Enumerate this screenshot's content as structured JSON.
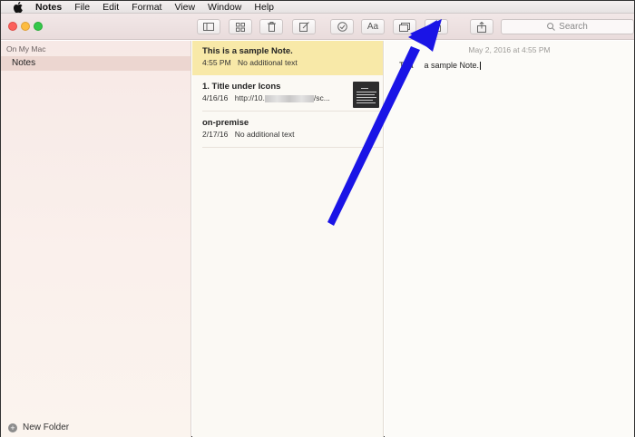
{
  "menubar": {
    "app_name": "Notes",
    "items": [
      "File",
      "Edit",
      "Format",
      "View",
      "Window",
      "Help"
    ]
  },
  "toolbar": {
    "buttons": [
      {
        "name": "sidebar-toggle-button",
        "icon": "sidebar-icon"
      },
      {
        "name": "gallery-view-button",
        "icon": "grid-icon"
      },
      {
        "name": "delete-button",
        "icon": "trash-icon"
      },
      {
        "name": "compose-button",
        "icon": "compose-icon"
      },
      {
        "name": "checklist-button",
        "icon": "checkmark-circle-icon"
      },
      {
        "name": "format-button",
        "icon": "text-format-icon",
        "label": "Aa"
      },
      {
        "name": "attachments-button",
        "icon": "attachments-icon"
      },
      {
        "name": "lock-button",
        "icon": "lock-icon"
      },
      {
        "name": "share-button",
        "icon": "share-icon"
      }
    ],
    "search_placeholder": "Search"
  },
  "sidebar": {
    "section": "On My Mac",
    "folders": [
      {
        "label": "Notes",
        "selected": true
      }
    ],
    "new_folder_label": "New Folder"
  },
  "notes": [
    {
      "title": "This is a sample Note.",
      "date": "4:55 PM",
      "preview": "No additional text",
      "selected": true
    },
    {
      "title": "1. Title under Icons",
      "date": "4/16/16",
      "preview_prefix": "http://10.",
      "preview_suffix": "/sc...",
      "has_thumbnail": true
    },
    {
      "title": "on-premise",
      "date": "2/17/16",
      "preview": "No additional text"
    }
  ],
  "editor": {
    "date": "May 2, 2016 at 4:55 PM",
    "body_visible_start": "Tha",
    "body_visible_end": "a sample Note."
  },
  "colors": {
    "selected_note": "#f8e9a8",
    "selected_folder": "#ecd6d0",
    "annotation_arrow": "#1a14e6"
  }
}
